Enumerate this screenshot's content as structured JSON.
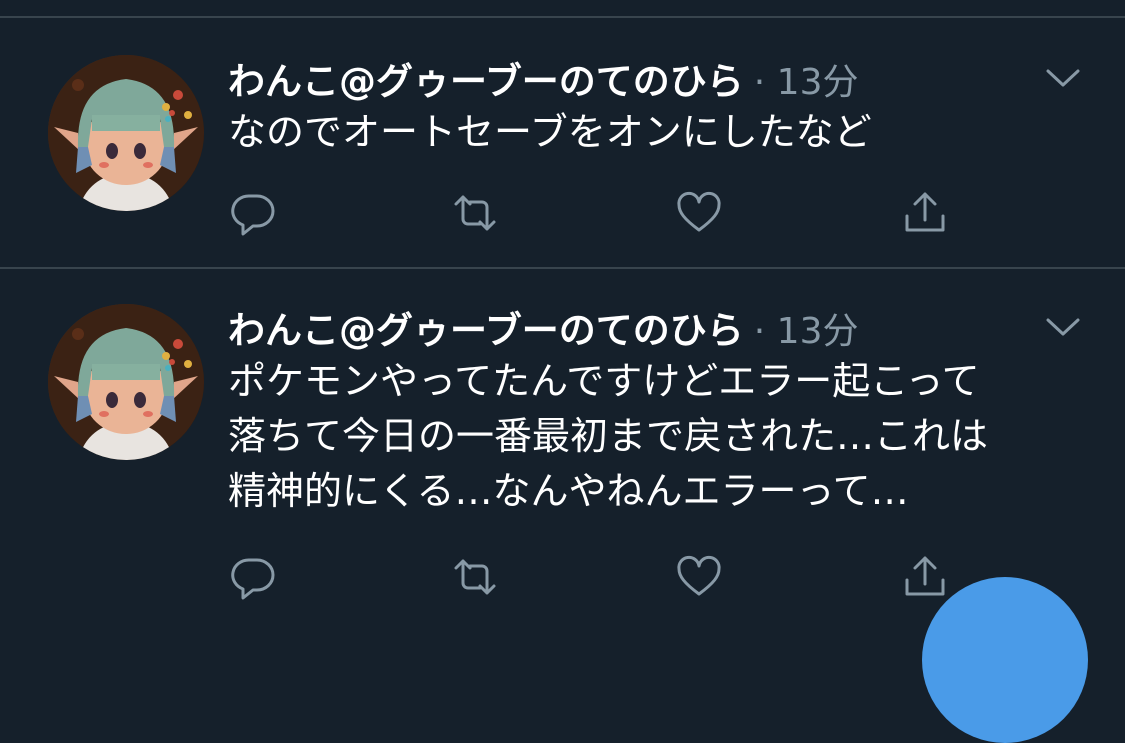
{
  "colors": {
    "background": "#15202b",
    "divider": "#38444d",
    "text": "#ffffff",
    "secondary_text": "#8899a6",
    "fab": "#4a9be8"
  },
  "tweets": [
    {
      "display_name": "わんこ@グゥーブーのてのひら",
      "meta": "· 13分",
      "text": "なのでオートセーブをオンにしたなど",
      "icons": [
        "reply-icon",
        "retweet-icon",
        "like-icon",
        "share-icon"
      ]
    },
    {
      "display_name": "わんこ@グゥーブーのてのひら",
      "meta": "· 13分",
      "text": "ポケモンやってたんですけどエラー起こって\n落ちて今日の一番最初まで戻された…これは\n精神的にくる…なんやねんエラーって…",
      "icons": [
        "reply-icon",
        "retweet-icon",
        "like-icon",
        "share-icon"
      ]
    }
  ]
}
